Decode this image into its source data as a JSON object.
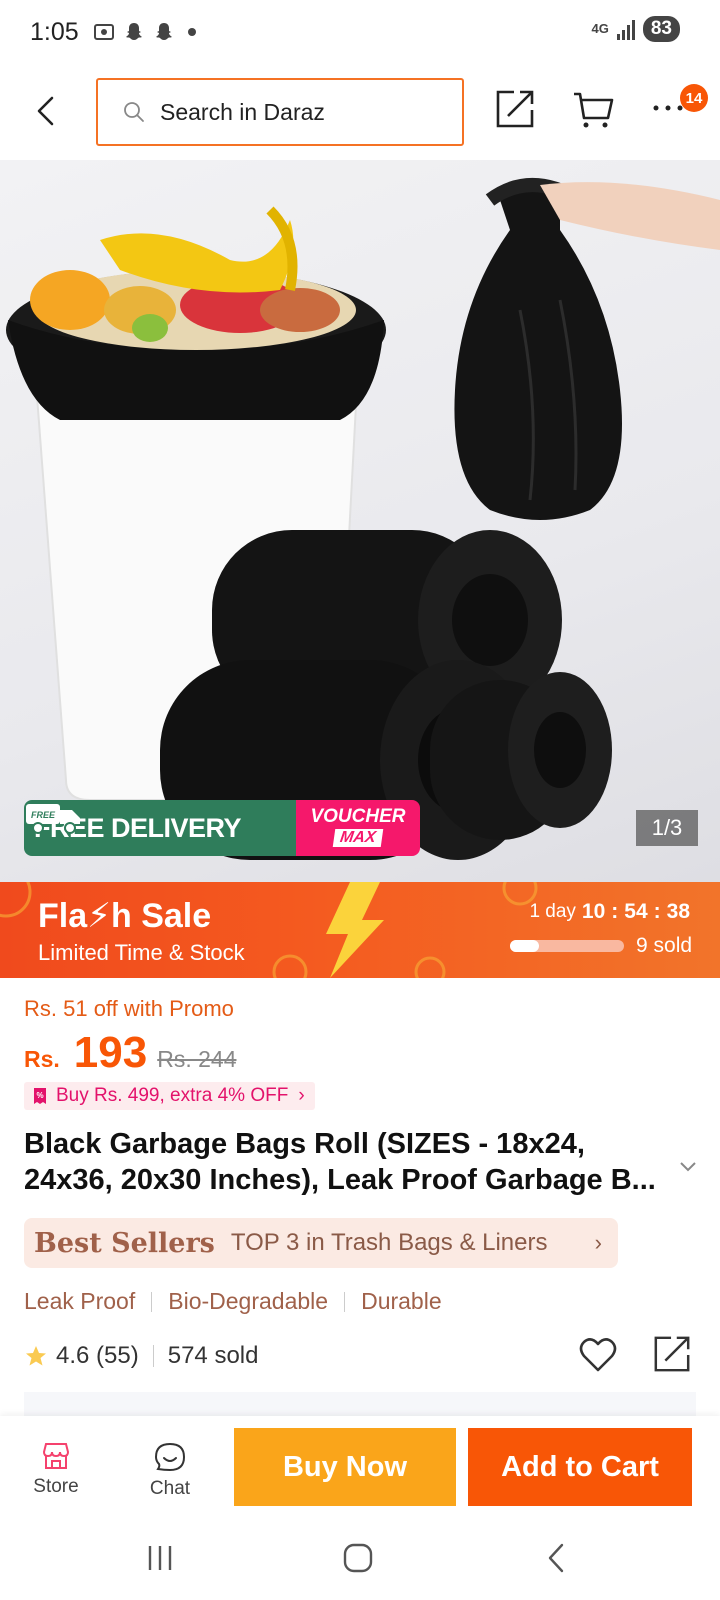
{
  "status_bar": {
    "time": "1:05",
    "network": "4G",
    "battery": "83"
  },
  "header": {
    "search_placeholder": "Search in Daraz",
    "cart_badge": "14",
    "icons": [
      "back-arrow-icon",
      "search-icon",
      "share-icon",
      "cart-icon",
      "more-icon"
    ]
  },
  "gallery": {
    "free_delivery_label": "FREE DELIVERY",
    "free_tag": "FREE",
    "voucher_line1": "VOUCHER",
    "voucher_line2": "MAX",
    "pager": "1/3"
  },
  "flash_sale": {
    "title": "Fla⚡h Sale",
    "subtitle": "Limited Time & Stock",
    "countdown_days": "1 day",
    "countdown_hours": "10",
    "countdown_minutes": "54",
    "countdown_seconds": "38",
    "sold": "9 sold",
    "progress_fraction": 0.25
  },
  "pricing": {
    "promo": "Rs. 51 off with Promo",
    "currency": "Rs.",
    "price": "193",
    "old_price": "Rs. 244",
    "extra_offer": "Buy Rs. 499, extra 4% OFF"
  },
  "product": {
    "title": "Black Garbage Bags Roll (SIZES - 18x24, 24x36, 20x30 Inches), Leak Proof Garbage B...",
    "best_sellers_label": "Best Sellers",
    "best_sellers_rank": "TOP 3 in Trash Bags & Liners",
    "tags": [
      "Leak Proof",
      "Bio-Degradable",
      "Durable"
    ],
    "rating": "4.6",
    "reviews": "(55)",
    "sold": "574 sold"
  },
  "bottom_bar": {
    "store_label": "Store",
    "chat_label": "Chat",
    "buy_now_label": "Buy Now",
    "add_to_cart_label": "Add to Cart"
  },
  "colors": {
    "accent": "#f85606",
    "buy_now": "#faa51a",
    "delivery_green": "#2f7d5b",
    "voucher_pink": "#f5186b"
  }
}
